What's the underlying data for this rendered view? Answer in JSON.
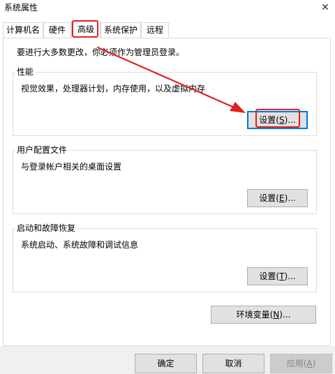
{
  "window": {
    "title": "系统属性",
    "close_glyph": "✕"
  },
  "tabs": [
    {
      "label": "计算机名",
      "active": false
    },
    {
      "label": "硬件",
      "active": false
    },
    {
      "label": "高级",
      "active": true
    },
    {
      "label": "系统保护",
      "active": false
    },
    {
      "label": "远程",
      "active": false
    }
  ],
  "notice": "要进行大多数更改，你必须作为管理员登录。",
  "groups": {
    "performance": {
      "title": "性能",
      "desc": "视觉效果，处理器计划，内存使用，以及虚拟内存",
      "button": {
        "pre": "设置(",
        "key": "S",
        "post": ")..."
      }
    },
    "user_profiles": {
      "title": "用户配置文件",
      "desc": "与登录帐户相关的桌面设置",
      "button": {
        "pre": "设置(",
        "key": "E",
        "post": ")..."
      }
    },
    "startup_recovery": {
      "title": "启动和故障恢复",
      "desc": "系统启动、系统故障和调试信息",
      "button": {
        "pre": "设置(",
        "key": "T",
        "post": ")..."
      }
    }
  },
  "env_button": {
    "pre": "环境变量(",
    "key": "N",
    "post": ")..."
  },
  "footer": {
    "ok": "确定",
    "cancel": "取消",
    "apply": {
      "pre": "应用(",
      "key": "A",
      "post": ")"
    }
  },
  "colors": {
    "annotation": "#e02020",
    "focus_border": "#0078d7"
  }
}
